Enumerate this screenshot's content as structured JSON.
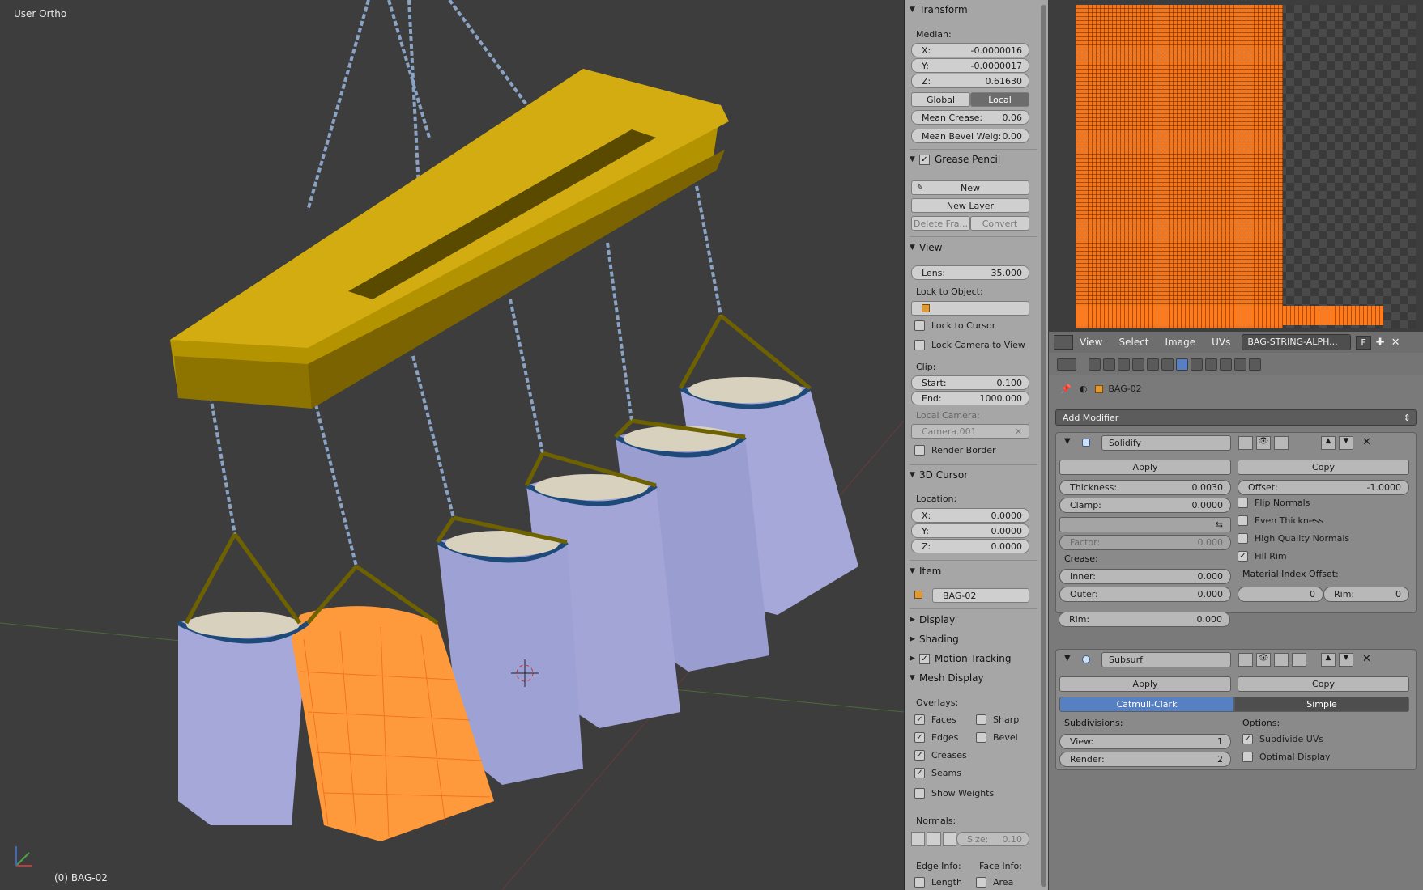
{
  "viewport": {
    "title": "User Ortho",
    "object_label": "(0) BAG-02"
  },
  "npanel": {
    "transform": {
      "header": "Transform",
      "median_label": "Median:",
      "x_label": "X:",
      "x": "-0.0000016",
      "y_label": "Y:",
      "y": "-0.0000017",
      "z_label": "Z:",
      "z": "0.61630",
      "global": "Global",
      "local": "Local",
      "mean_crease_label": "Mean Crease:",
      "mean_crease": "0.06",
      "mean_bevel_label": "Mean Bevel Weig:",
      "mean_bevel": "0.00"
    },
    "grease": {
      "header": "Grease Pencil",
      "new": "New",
      "new_layer": "New Layer",
      "delete_frame": "Delete Fra...",
      "convert": "Convert"
    },
    "view": {
      "header": "View",
      "lens_label": "Lens:",
      "lens": "35.000",
      "lock_object": "Lock to Object:",
      "lock_cursor": "Lock to Cursor",
      "lock_camera": "Lock Camera to View",
      "clip": "Clip:",
      "start_label": "Start:",
      "start": "0.100",
      "end_label": "End:",
      "end": "1000.000",
      "local_camera": "Local Camera:",
      "camera": "Camera.001",
      "render_border": "Render Border"
    },
    "cursor": {
      "header": "3D Cursor",
      "location": "Location:",
      "x_label": "X:",
      "x": "0.0000",
      "y_label": "Y:",
      "y": "0.0000",
      "z_label": "Z:",
      "z": "0.0000"
    },
    "item": {
      "header": "Item",
      "name": "BAG-02"
    },
    "display": {
      "header": "Display"
    },
    "shading": {
      "header": "Shading"
    },
    "motion": {
      "header": "Motion Tracking"
    },
    "mesh": {
      "header": "Mesh Display",
      "overlays": "Overlays:",
      "faces": "Faces",
      "sharp": "Sharp",
      "edges": "Edges",
      "bevel": "Bevel",
      "creases": "Creases",
      "seams": "Seams",
      "show_weights": "Show Weights",
      "normals": "Normals:",
      "size_label": "Size:",
      "size": "0.10",
      "edge_info": "Edge Info:",
      "face_info": "Face Info:",
      "length": "Length",
      "area": "Area"
    }
  },
  "uv_header": {
    "view": "View",
    "select": "Select",
    "image": "Image",
    "uvs": "UVs",
    "image_name": "BAG-STRING-ALPH...",
    "f": "F"
  },
  "properties": {
    "object": "BAG-02",
    "add_modifier": "Add Modifier",
    "solidify": {
      "name": "Solidify",
      "apply": "Apply",
      "copy": "Copy",
      "thickness_label": "Thickness:",
      "thickness": "0.0030",
      "offset_label": "Offset:",
      "offset": "-1.0000",
      "clamp_label": "Clamp:",
      "clamp": "0.0000",
      "flip_normals": "Flip Normals",
      "even_thickness": "Even Thickness",
      "high_quality": "High Quality Normals",
      "fill_rim": "Fill Rim",
      "factor_label": "Factor:",
      "factor": "0.000",
      "crease": "Crease:",
      "inner_label": "Inner:",
      "inner": "0.000",
      "outer_label": "Outer:",
      "outer": "0.000",
      "rim_label": "Rim:",
      "rim": "0.000",
      "mat_offset": "Material Index Offset:",
      "mat_val": "0",
      "rim2_label": "Rim:",
      "rim2": "0"
    },
    "subsurf": {
      "name": "Subsurf",
      "apply": "Apply",
      "copy": "Copy",
      "catmull": "Catmull-Clark",
      "simple": "Simple",
      "subdivisions": "Subdivisions:",
      "options": "Options:",
      "view_label": "View:",
      "view": "1",
      "render_label": "Render:",
      "render": "2",
      "subdivide_uvs": "Subdivide UVs",
      "optimal_display": "Optimal Display"
    }
  },
  "colors": {
    "accent": "#5680c2",
    "selected_orange": "#ff8a2a",
    "beam": "#c9a500",
    "bag": "#a5a8d8",
    "strap": "#1e4a7a"
  }
}
